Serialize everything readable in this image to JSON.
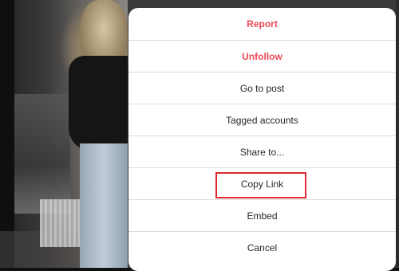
{
  "menu": {
    "items": [
      {
        "id": "report",
        "label": "Report",
        "style": "danger"
      },
      {
        "id": "unfollow",
        "label": "Unfollow",
        "style": "danger"
      },
      {
        "id": "go-to-post",
        "label": "Go to post",
        "style": "normal"
      },
      {
        "id": "tagged-accounts",
        "label": "Tagged accounts",
        "style": "normal"
      },
      {
        "id": "share-to",
        "label": "Share to...",
        "style": "normal"
      },
      {
        "id": "copy-link",
        "label": "Copy Link",
        "style": "normal",
        "highlighted": true
      },
      {
        "id": "embed",
        "label": "Embed",
        "style": "normal"
      },
      {
        "id": "cancel",
        "label": "Cancel",
        "style": "normal"
      }
    ]
  },
  "colors": {
    "danger": "#ed4956",
    "text": "#262626",
    "divider": "#dbdbdb",
    "highlight_border": "#e0282f",
    "modal_bg": "#ffffff"
  }
}
